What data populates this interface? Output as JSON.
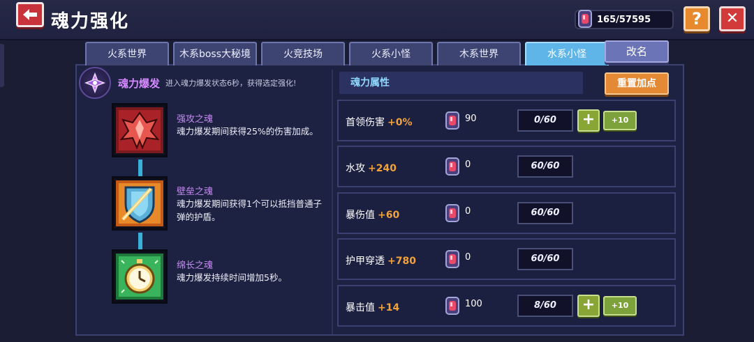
{
  "header": {
    "title": "魂力强化",
    "currency": "165/57595",
    "help_label": "?",
    "close_label": "✕"
  },
  "tabs": [
    {
      "label": "火系世界"
    },
    {
      "label": "木系boss大秘境"
    },
    {
      "label": "火竞技场"
    },
    {
      "label": "火系小怪"
    },
    {
      "label": "木系世界"
    },
    {
      "label": "水系小怪",
      "active": true
    }
  ],
  "rename_label": "改名",
  "burst": {
    "title": "魂力爆发",
    "description": "进入魂力爆发状态6秒，获得选定强化!"
  },
  "souls": [
    {
      "name": "强攻之魂",
      "desc": "魂力爆发期间获得25%的伤害加成。",
      "icon": "red-claw-icon"
    },
    {
      "name": "壁垒之魂",
      "desc": "魂力爆发期间获得1个可以抵挡普通子弹的护盾。",
      "icon": "shield-sword-icon"
    },
    {
      "name": "绵长之魂",
      "desc": "魂力爆发持续时间增加5秒。",
      "icon": "stopwatch-icon"
    }
  ],
  "attributes": {
    "header": "魂力属性",
    "reset_label": "重置加点",
    "plus_label": "+",
    "plus10_label": "+10",
    "rows": [
      {
        "label": "首领伤害",
        "bonus": "+0%",
        "cost": "90",
        "level": "0/60"
      },
      {
        "label": "水攻",
        "bonus": "+240",
        "cost": "0",
        "level": "60/60"
      },
      {
        "label": "暴伤值",
        "bonus": "+60",
        "cost": "0",
        "level": "60/60"
      },
      {
        "label": "护甲穿透",
        "bonus": "+780",
        "cost": "0",
        "level": "60/60"
      },
      {
        "label": "暴击值",
        "bonus": "+14",
        "cost": "100",
        "level": "8/60"
      }
    ]
  },
  "colors": {
    "accent_orange": "#f2a23a",
    "active_tab": "#5fb4e8",
    "soul_name": "#c48cf0"
  }
}
